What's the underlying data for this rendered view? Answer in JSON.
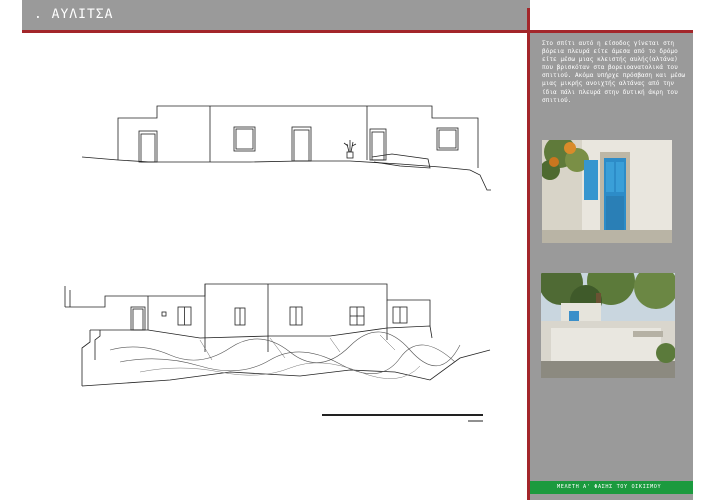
{
  "header": {
    "title": ". ΑΥΛΙΤΣΑ"
  },
  "sidebar": {
    "description": "Στο σπίτι αυτό η είσοδος γίνεται στη βόρεια πλευρά είτε άμεσα από το δρόμο είτε μέσω μιας κλειστής αυλής(αλτάνα) που βρισκόταν στα βορειοανατολικά του σπιτιού. Ακόμα υπήρχε πρόσβαση και μέσω μιας μικρής ανοιχτής αλτάνας από την ίδια πάλι πλευρά στην δυτική άκρη του σπιτιού.",
    "footer": "ΜΕΛΕΤΗ Α' ΦΑΣΗΣ ΤΟΥ ΟΙΚΙΣΜΟΥ"
  },
  "colors": {
    "accent_red": "#a3262a",
    "panel_gray": "#9a9a9a",
    "footer_green": "#1b9a3e"
  }
}
